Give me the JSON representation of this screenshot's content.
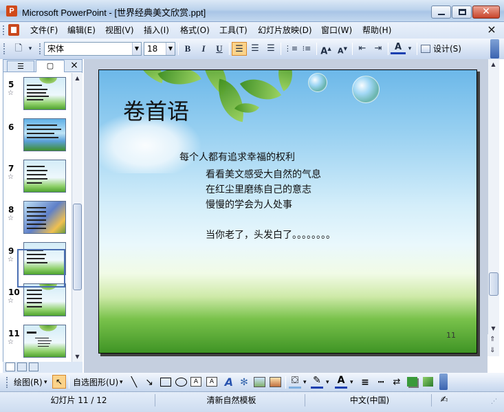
{
  "window": {
    "title": "Microsoft PowerPoint - [世界经典美文欣赏.ppt]",
    "app_icon": "P"
  },
  "menu": {
    "items": [
      "文件(F)",
      "编辑(E)",
      "视图(V)",
      "插入(I)",
      "格式(O)",
      "工具(T)",
      "幻灯片放映(D)",
      "窗口(W)",
      "帮助(H)"
    ],
    "close": "×"
  },
  "toolbar": {
    "font_name": "宋体",
    "font_size": "18",
    "bold": "B",
    "italic": "I",
    "underline": "U",
    "design_label": "设计(S)",
    "font_color_glyph": "A"
  },
  "thumbnails": [
    {
      "num": "5",
      "star": "☆"
    },
    {
      "num": "6",
      "star": ""
    },
    {
      "num": "7",
      "star": "☆"
    },
    {
      "num": "8",
      "star": "☆"
    },
    {
      "num": "9",
      "star": "☆"
    },
    {
      "num": "10",
      "star": "☆"
    },
    {
      "num": "11",
      "star": "☆"
    }
  ],
  "panel_close": "×",
  "slide": {
    "title": "卷首语",
    "lines": [
      "每个人都有追求幸福的权利",
      "看看美文感受大自然的气息",
      "在红尘里磨练自己的意志",
      "慢慢的学会为人处事",
      "当你老了，头发白了。。。。。。。。"
    ],
    "page_number": "11"
  },
  "drawing_toolbar": {
    "draw_menu": "绘图(R)",
    "autoshapes_menu": "自选图形(U)"
  },
  "status": {
    "slide": "幻灯片 11 / 12",
    "template": "清新自然模板",
    "language": "中文(中国)"
  }
}
